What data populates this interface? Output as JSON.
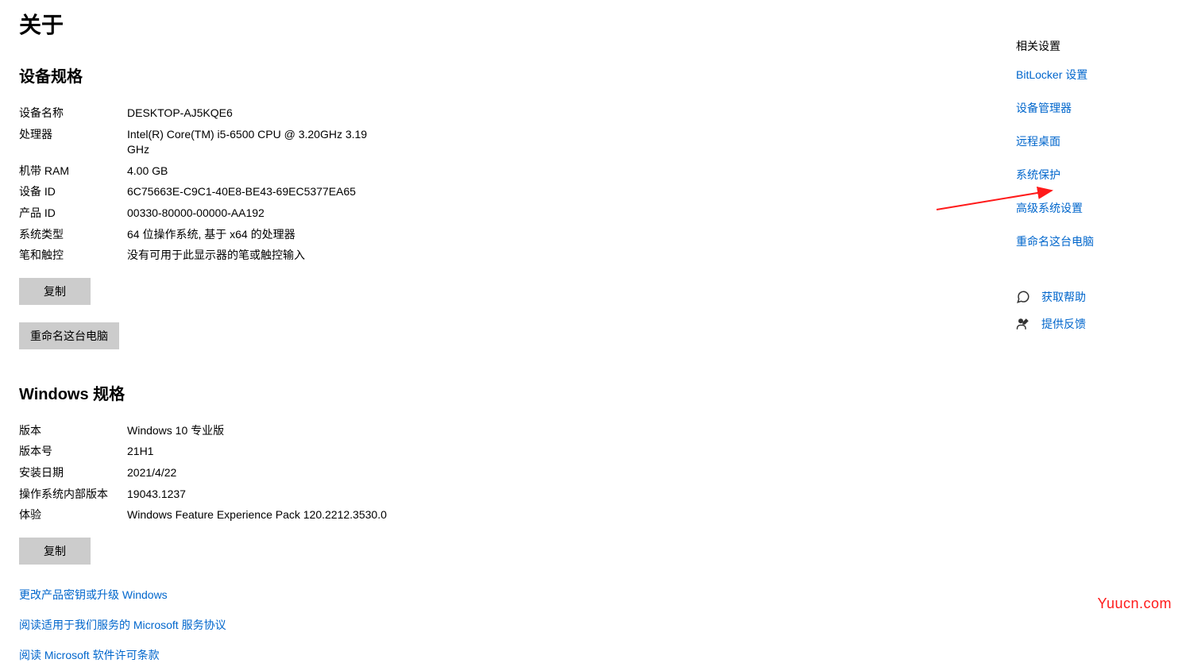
{
  "page_title": "关于",
  "device_spec": {
    "heading": "设备规格",
    "rows": [
      {
        "label": "设备名称",
        "value": "DESKTOP-AJ5KQE6"
      },
      {
        "label": "处理器",
        "value": "Intel(R) Core(TM) i5-6500 CPU @ 3.20GHz   3.19 GHz"
      },
      {
        "label": "机带 RAM",
        "value": "4.00 GB"
      },
      {
        "label": "设备 ID",
        "value": "6C75663E-C9C1-40E8-BE43-69EC5377EA65"
      },
      {
        "label": "产品 ID",
        "value": "00330-80000-00000-AA192"
      },
      {
        "label": "系统类型",
        "value": "64 位操作系统, 基于 x64 的处理器"
      },
      {
        "label": "笔和触控",
        "value": "没有可用于此显示器的笔或触控输入"
      }
    ],
    "copy_button": "复制",
    "rename_button": "重命名这台电脑"
  },
  "windows_spec": {
    "heading": "Windows 规格",
    "rows": [
      {
        "label": "版本",
        "value": "Windows 10 专业版"
      },
      {
        "label": "版本号",
        "value": "21H1"
      },
      {
        "label": "安装日期",
        "value": "2021/4/22"
      },
      {
        "label": "操作系统内部版本",
        "value": "19043.1237"
      },
      {
        "label": "体验",
        "value": "Windows Feature Experience Pack 120.2212.3530.0"
      }
    ],
    "copy_button": "复制"
  },
  "bottom_links": [
    "更改产品密钥或升级 Windows",
    "阅读适用于我们服务的 Microsoft 服务协议",
    "阅读 Microsoft 软件许可条款"
  ],
  "related": {
    "heading": "相关设置",
    "links": [
      "BitLocker 设置",
      "设备管理器",
      "远程桌面",
      "系统保护",
      "高级系统设置",
      "重命名这台电脑"
    ]
  },
  "help": {
    "get_help": "获取帮助",
    "feedback": "提供反馈"
  },
  "watermark": "Yuucn.com"
}
